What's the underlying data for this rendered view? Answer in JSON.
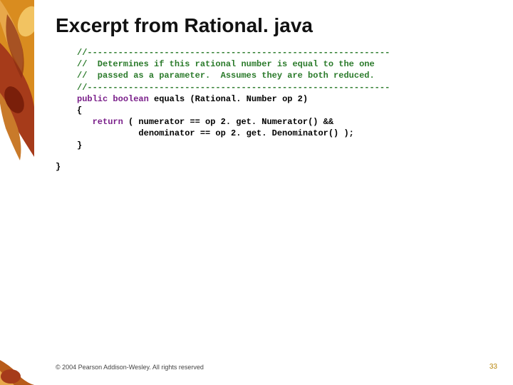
{
  "title": "Excerpt from Rational. java",
  "code": {
    "sep": "//-----------------------------------------------------------",
    "c1": "//  Determines if this rational number is equal to the one",
    "c2": "//  passed as a parameter.  Assumes they are both reduced.",
    "kw_public": "public",
    "kw_boolean": "boolean",
    "sig_rest": " equals (Rational. Number op 2)",
    "brace_open": "{",
    "kw_return": "return",
    "ret1": " ( numerator == op 2. get. Numerator() &&",
    "ret2": "            denominator == op 2. get. Denominator() );",
    "brace_close": "}",
    "outer_close": "}"
  },
  "footer": "© 2004 Pearson Addison-Wesley. All rights reserved",
  "page_number": "33"
}
